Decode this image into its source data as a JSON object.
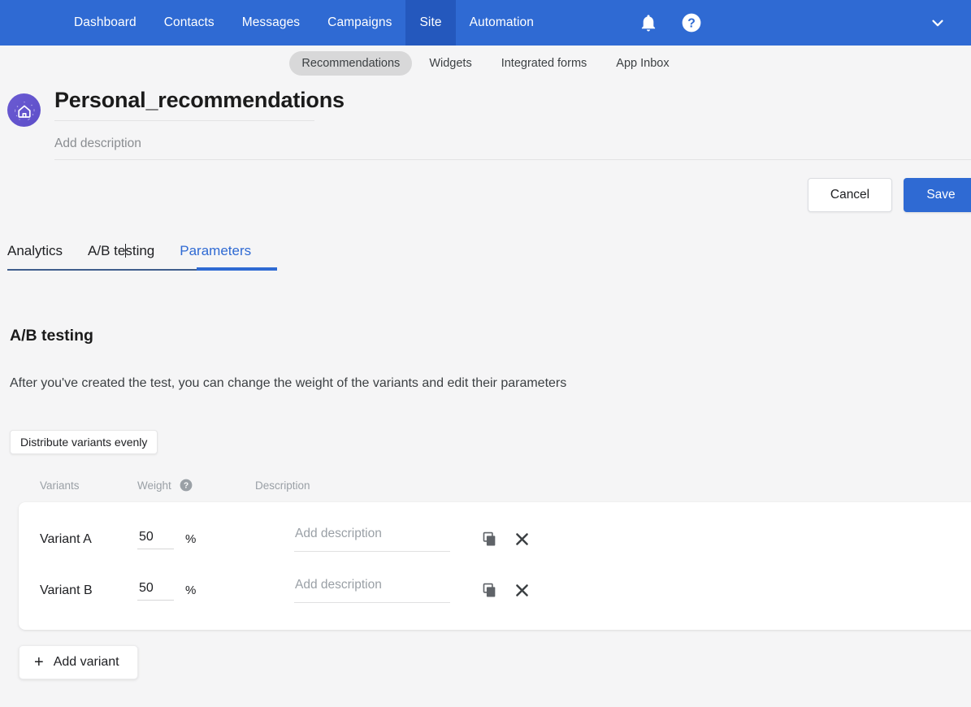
{
  "topnav": {
    "items": [
      {
        "label": "Dashboard",
        "active": false
      },
      {
        "label": "Contacts",
        "active": false
      },
      {
        "label": "Messages",
        "active": false
      },
      {
        "label": "Campaigns",
        "active": false
      },
      {
        "label": "Site",
        "active": true
      },
      {
        "label": "Automation",
        "active": false
      }
    ],
    "icons": {
      "notifications": "bell-icon",
      "help": "help-circle-icon",
      "account_menu": "chevron-down-icon"
    },
    "background_color": "#2f6ad3",
    "active_background_color": "#2458bd"
  },
  "subnav": {
    "items": [
      {
        "label": "Recommendations",
        "active": true
      },
      {
        "label": "Widgets",
        "active": false
      },
      {
        "label": "Integrated forms",
        "active": false
      },
      {
        "label": "App Inbox",
        "active": false
      }
    ]
  },
  "header": {
    "avatar_icon": "home-icon",
    "title": "Personal_recommendations",
    "description_value": "",
    "description_placeholder": "Add description"
  },
  "actions": {
    "cancel_label": "Cancel",
    "save_label": "Save",
    "save_color": "#2f6ad3"
  },
  "tabs": [
    {
      "label": "Analytics",
      "active": false
    },
    {
      "label": "A/B testing",
      "active": false,
      "caret_after": "A/B te"
    },
    {
      "label": "Parameters",
      "active": true
    }
  ],
  "tab_accent_color": "#2f6ad3",
  "section": {
    "title": "A/B testing",
    "subtitle": "After you've created the test, you can change the weight of the variants and edit their parameters",
    "distribute_label": "Distribute variants evenly"
  },
  "table": {
    "columns": [
      "Variants",
      "Weight",
      "Description"
    ],
    "weight_help_icon": "help-circle-icon",
    "weight_unit": "%",
    "description_placeholder": "Add description",
    "row_icons": {
      "duplicate": "copy-icon",
      "remove": "close-icon"
    },
    "rows": [
      {
        "name": "Variant A",
        "weight": "50",
        "description": ""
      },
      {
        "name": "Variant B",
        "weight": "50",
        "description": ""
      }
    ]
  },
  "add_variant": {
    "label": "Add variant",
    "icon": "plus-icon"
  }
}
